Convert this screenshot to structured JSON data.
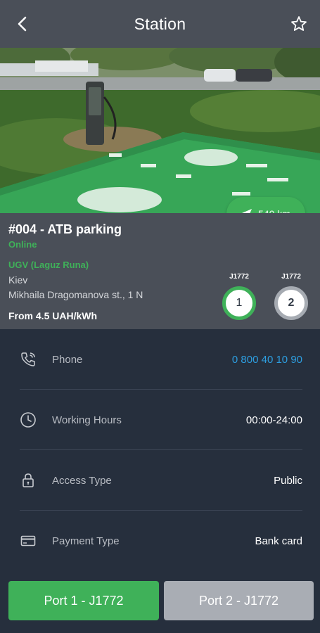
{
  "header": {
    "title": "Station",
    "back_icon": "chevron-left-icon",
    "favorite_icon": "star-outline-icon"
  },
  "photo": {
    "description_icon": "station-photo"
  },
  "distance": {
    "label": "540 km",
    "icon": "navigation-arrow-icon"
  },
  "station": {
    "name": "#004 - ATB parking",
    "status": "Online",
    "operator": "UGV (Laguz Runa)",
    "city": "Kiev",
    "street": "Mikhaila Dragomanova st., 1 N",
    "price": "From 4.5 UAH/kWh"
  },
  "connectors": [
    {
      "type": "J1772",
      "number": "1",
      "color": "#3fb159"
    },
    {
      "type": "J1772",
      "number": "2",
      "color": "#a6abb2"
    }
  ],
  "details": [
    {
      "icon": "phone-icon",
      "label": "Phone",
      "value": "0 800 40 10 90",
      "link": true
    },
    {
      "icon": "clock-icon",
      "label": "Working Hours",
      "value": "00:00-24:00",
      "link": false
    },
    {
      "icon": "lock-icon",
      "label": "Access Type",
      "value": "Public",
      "link": false
    },
    {
      "icon": "card-icon",
      "label": "Payment Type",
      "value": "Bank card",
      "link": false
    }
  ],
  "ports": [
    {
      "label": "Port 1 - J1772",
      "active": true
    },
    {
      "label": "Port 2 - J1772",
      "active": false
    }
  ],
  "colors": {
    "accent": "#3fb159",
    "link": "#2d9ee0",
    "header_bg": "#4a4f58",
    "body_bg": "#262f3d"
  }
}
